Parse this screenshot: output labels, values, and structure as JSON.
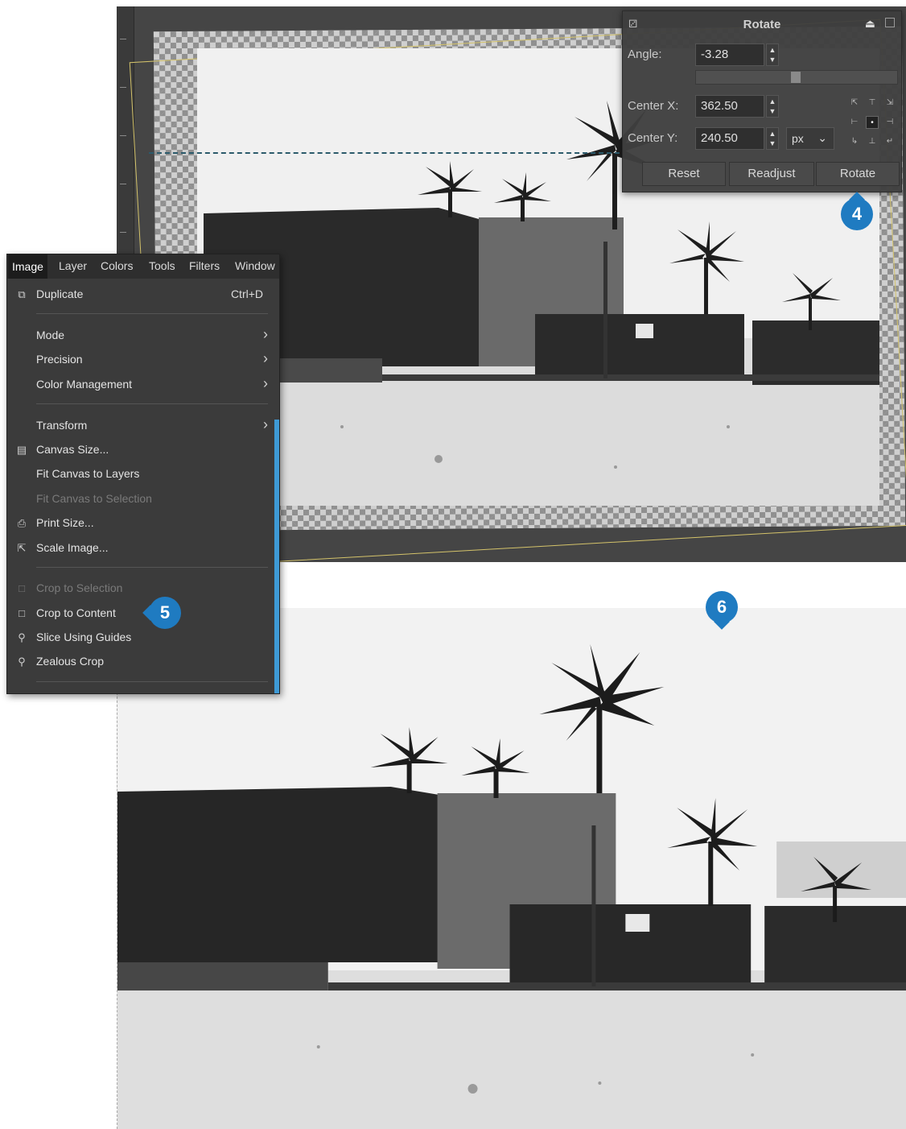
{
  "rotate_dialog": {
    "title": "Rotate",
    "angle_label": "Angle:",
    "angle_value": "-3.28",
    "center_x_label": "Center X:",
    "center_x_value": "362.50",
    "center_y_label": "Center Y:",
    "center_y_value": "240.50",
    "unit": "px",
    "buttons": {
      "reset": "Reset",
      "readjust": "Readjust",
      "rotate": "Rotate"
    }
  },
  "markers": {
    "m4": "4",
    "m5": "5",
    "m6": "6"
  },
  "menu": {
    "menubar": [
      "Image",
      "Layer",
      "Colors",
      "Tools",
      "Filters",
      "Window"
    ],
    "items": [
      {
        "label": "Duplicate",
        "shortcut": "Ctrl+D",
        "icon": "duplicate-icon"
      },
      {
        "label": "Mode",
        "submenu": true
      },
      {
        "label": "Precision",
        "submenu": true
      },
      {
        "label": "Color Management",
        "submenu": true
      },
      {
        "label": "Transform",
        "submenu": true
      },
      {
        "label": "Canvas Size...",
        "icon": "canvas-size-icon"
      },
      {
        "label": "Fit Canvas to Layers"
      },
      {
        "label": "Fit Canvas to Selection",
        "disabled": true
      },
      {
        "label": "Print Size...",
        "icon": "printer-icon"
      },
      {
        "label": "Scale Image...",
        "icon": "scale-image-icon"
      },
      {
        "label": "Crop to Selection",
        "disabled": true,
        "icon": "crop-icon"
      },
      {
        "label": "Crop to Content",
        "icon": "crop-icon"
      },
      {
        "label": "Slice Using Guides",
        "icon": "slice-icon"
      },
      {
        "label": "Zealous Crop",
        "icon": "zealous-crop-icon"
      }
    ]
  },
  "colors": {
    "marker_blue": "#1f7bc1",
    "selection_blue": "#3e9ad6"
  }
}
